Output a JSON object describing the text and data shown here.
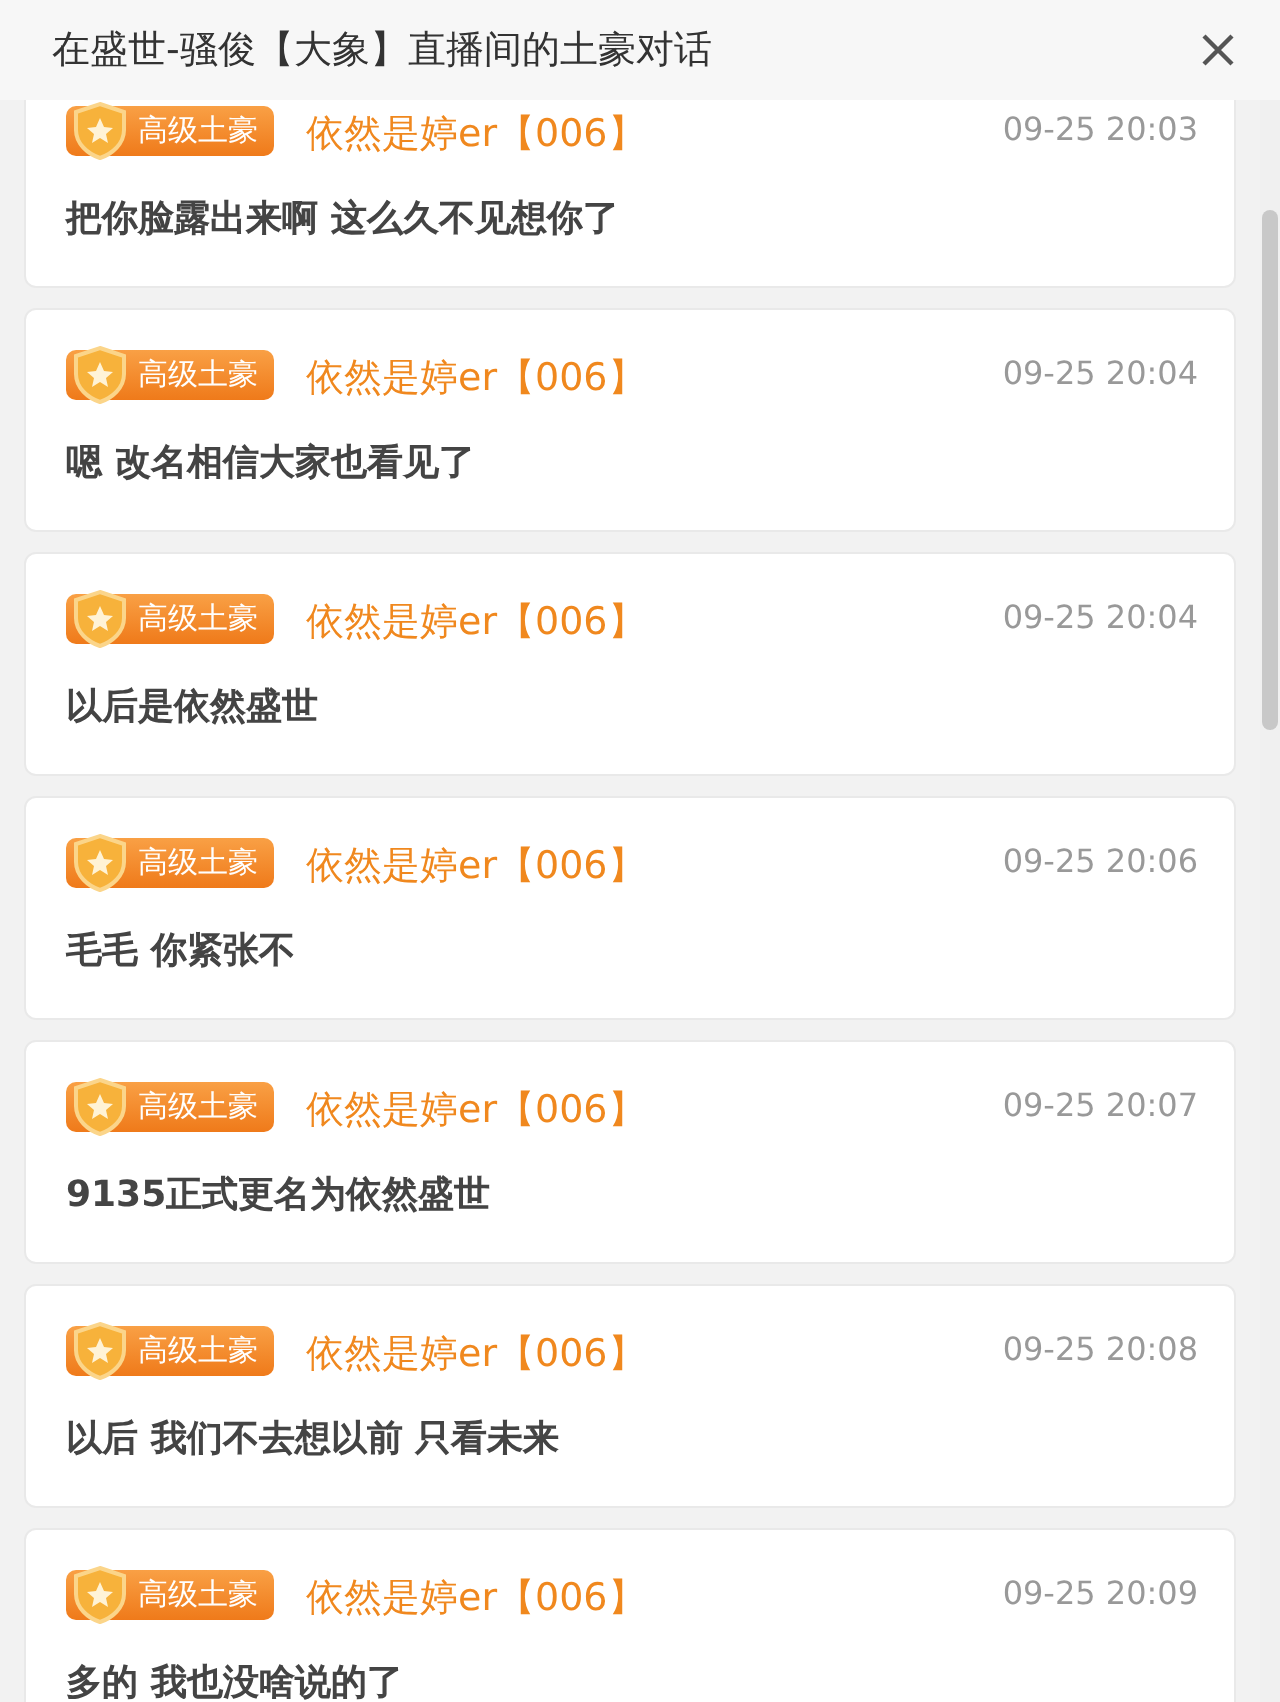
{
  "window": {
    "title": "在盛世-骚俊【大象】直播间的土豪对话"
  },
  "messages": [
    {
      "badge": "高级土豪",
      "user": "依然是婷er【006】",
      "time": "09-25 20:03",
      "text": "把你脸露出来啊 这么久不见想你了"
    },
    {
      "badge": "高级土豪",
      "user": "依然是婷er【006】",
      "time": "09-25 20:04",
      "text": "嗯 改名相信大家也看见了"
    },
    {
      "badge": "高级土豪",
      "user": "依然是婷er【006】",
      "time": "09-25 20:04",
      "text": "以后是依然盛世"
    },
    {
      "badge": "高级土豪",
      "user": "依然是婷er【006】",
      "time": "09-25 20:06",
      "text": "毛毛 你紧张不"
    },
    {
      "badge": "高级土豪",
      "user": "依然是婷er【006】",
      "time": "09-25 20:07",
      "text": "9135正式更名为依然盛世"
    },
    {
      "badge": "高级土豪",
      "user": "依然是婷er【006】",
      "time": "09-25 20:08",
      "text": "以后 我们不去想以前 只看未来"
    },
    {
      "badge": "高级土豪",
      "user": "依然是婷er【006】",
      "time": "09-25 20:09",
      "text": "多的 我也没啥说的了"
    }
  ]
}
